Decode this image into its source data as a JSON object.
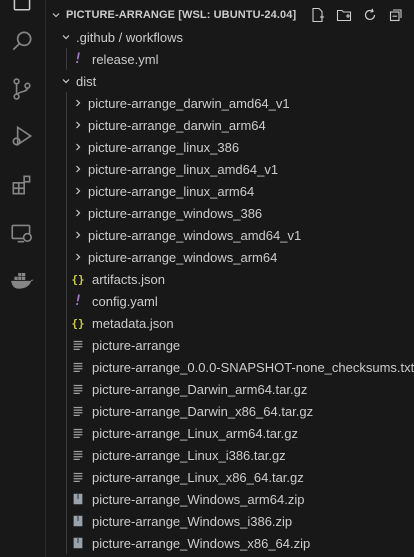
{
  "explorer": {
    "title": "PICTURE-ARRANGE [WSL: UBUNTU-24.04]"
  },
  "tree": [
    {
      "label_a": ".github",
      "label_b": "workflows",
      "indent": 1,
      "kind": "folder-open"
    },
    {
      "label": "release.yml",
      "indent": 2,
      "kind": "yaml"
    },
    {
      "label": "dist",
      "indent": 1,
      "kind": "folder-open"
    },
    {
      "label": "picture-arrange_darwin_amd64_v1",
      "indent": 2,
      "kind": "folder"
    },
    {
      "label": "picture-arrange_darwin_arm64",
      "indent": 2,
      "kind": "folder"
    },
    {
      "label": "picture-arrange_linux_386",
      "indent": 2,
      "kind": "folder"
    },
    {
      "label": "picture-arrange_linux_amd64_v1",
      "indent": 2,
      "kind": "folder"
    },
    {
      "label": "picture-arrange_linux_arm64",
      "indent": 2,
      "kind": "folder"
    },
    {
      "label": "picture-arrange_windows_386",
      "indent": 2,
      "kind": "folder"
    },
    {
      "label": "picture-arrange_windows_amd64_v1",
      "indent": 2,
      "kind": "folder"
    },
    {
      "label": "picture-arrange_windows_arm64",
      "indent": 2,
      "kind": "folder"
    },
    {
      "label": "artifacts.json",
      "indent": 2,
      "kind": "json"
    },
    {
      "label": "config.yaml",
      "indent": 2,
      "kind": "yaml"
    },
    {
      "label": "metadata.json",
      "indent": 2,
      "kind": "json"
    },
    {
      "label": "picture-arrange",
      "indent": 2,
      "kind": "text"
    },
    {
      "label": "picture-arrange_0.0.0-SNAPSHOT-none_checksums.txt",
      "indent": 2,
      "kind": "text"
    },
    {
      "label": "picture-arrange_Darwin_arm64.tar.gz",
      "indent": 2,
      "kind": "text"
    },
    {
      "label": "picture-arrange_Darwin_x86_64.tar.gz",
      "indent": 2,
      "kind": "text"
    },
    {
      "label": "picture-arrange_Linux_arm64.tar.gz",
      "indent": 2,
      "kind": "text"
    },
    {
      "label": "picture-arrange_Linux_i386.tar.gz",
      "indent": 2,
      "kind": "text"
    },
    {
      "label": "picture-arrange_Linux_x86_64.tar.gz",
      "indent": 2,
      "kind": "text"
    },
    {
      "label": "picture-arrange_Windows_arm64.zip",
      "indent": 2,
      "kind": "zip"
    },
    {
      "label": "picture-arrange_Windows_i386.zip",
      "indent": 2,
      "kind": "zip"
    },
    {
      "label": "picture-arrange_Windows_x86_64.zip",
      "indent": 2,
      "kind": "zip"
    }
  ],
  "colors": {
    "background": "#181818",
    "text": "#cccccc",
    "yaml_icon": "#a074c4",
    "json_icon": "#cbcb41",
    "file_icon": "#a0a0a0",
    "zip_icon": "#9aa3ab"
  }
}
